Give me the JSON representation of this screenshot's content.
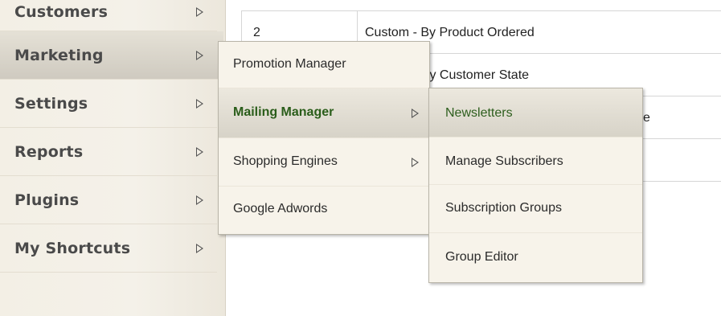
{
  "sidebar": {
    "items": [
      {
        "label": "Customers"
      },
      {
        "label": "Marketing"
      },
      {
        "label": "Settings"
      },
      {
        "label": "Reports"
      },
      {
        "label": "Plugins"
      },
      {
        "label": "My Shortcuts"
      }
    ]
  },
  "table": {
    "rows": [
      {
        "num": "2",
        "text": "Custom - By Product Ordered"
      },
      {
        "num": "",
        "text": "- By Customer State"
      },
      {
        "num": "",
        "text": "e"
      }
    ]
  },
  "marketing_menu": {
    "items": [
      {
        "label": "Promotion Manager"
      },
      {
        "label": "Mailing Manager"
      },
      {
        "label": "Shopping Engines"
      },
      {
        "label": "Google Adwords"
      }
    ]
  },
  "mailing_menu": {
    "items": [
      {
        "label": "Newsletters"
      },
      {
        "label": "Manage Subscribers"
      },
      {
        "label": "Subscription Groups"
      },
      {
        "label": "Group Editor"
      }
    ]
  },
  "colors": {
    "active_text": "#2a5d1a",
    "menu_bg": "#f7f3ea",
    "sidebar_bg": "#f3efe5"
  }
}
